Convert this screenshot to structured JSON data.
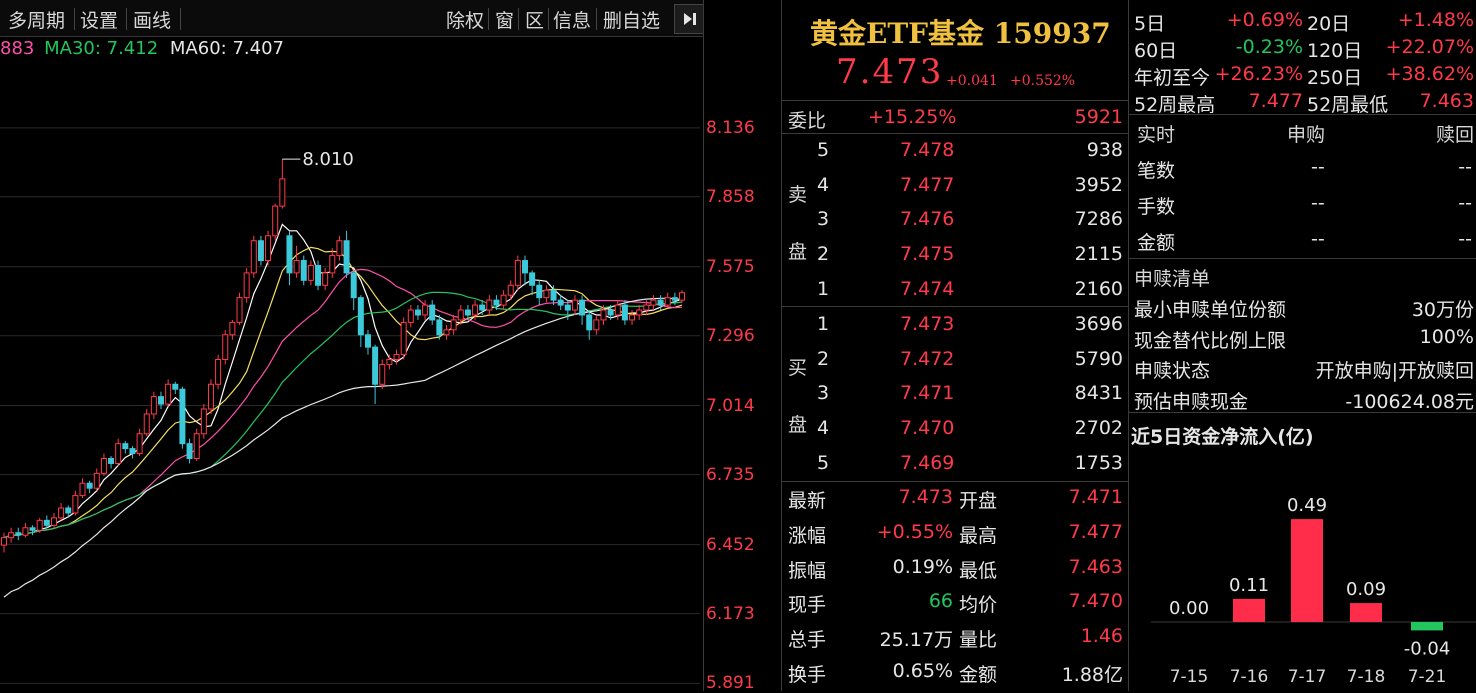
{
  "toolbar": {
    "multi_period": "多周期",
    "settings": "设置",
    "draw_line": "画线",
    "ex_right": "除权",
    "window": "窗",
    "section": "区",
    "info": "信息",
    "remove_watch": "删自选"
  },
  "ma_legend": {
    "ma_partial": "883",
    "ma30": "MA30: 7.412",
    "ma60": "MA60: 7.407"
  },
  "chart_data": {
    "type": "candlestick",
    "y_ticks": [
      "8.136",
      "7.858",
      "7.575",
      "7.296",
      "7.014",
      "6.735",
      "6.452",
      "6.173",
      "5.891"
    ],
    "y_tick_values": [
      8.136,
      7.858,
      7.575,
      7.296,
      7.014,
      6.735,
      6.452,
      6.173,
      5.891
    ],
    "ylim": [
      5.82,
      8.37
    ],
    "peak_label": "8.010",
    "peak_value": 8.01,
    "candles": [
      [
        6.45,
        6.48,
        6.42,
        6.5
      ],
      [
        6.48,
        6.5,
        6.46,
        6.52
      ],
      [
        6.5,
        6.49,
        6.47,
        6.52
      ],
      [
        6.49,
        6.52,
        6.48,
        6.54
      ],
      [
        6.52,
        6.51,
        6.49,
        6.53
      ],
      [
        6.51,
        6.55,
        6.5,
        6.56
      ],
      [
        6.55,
        6.53,
        6.52,
        6.57
      ],
      [
        6.53,
        6.56,
        6.52,
        6.58
      ],
      [
        6.56,
        6.6,
        6.55,
        6.62
      ],
      [
        6.6,
        6.58,
        6.56,
        6.61
      ],
      [
        6.58,
        6.65,
        6.57,
        6.67
      ],
      [
        6.65,
        6.7,
        6.64,
        6.72
      ],
      [
        6.7,
        6.68,
        6.66,
        6.71
      ],
      [
        6.68,
        6.74,
        6.67,
        6.76
      ],
      [
        6.74,
        6.8,
        6.73,
        6.82
      ],
      [
        6.8,
        6.78,
        6.76,
        6.81
      ],
      [
        6.78,
        6.86,
        6.77,
        6.88
      ],
      [
        6.86,
        6.84,
        6.82,
        6.87
      ],
      [
        6.84,
        6.82,
        6.8,
        6.85
      ],
      [
        6.82,
        6.9,
        6.81,
        6.92
      ],
      [
        6.9,
        6.98,
        6.89,
        7.0
      ],
      [
        6.98,
        7.05,
        6.96,
        7.07
      ],
      [
        7.05,
        7.02,
        7.0,
        7.07
      ],
      [
        7.02,
        7.1,
        7.01,
        7.12
      ],
      [
        7.1,
        7.08,
        7.06,
        7.11
      ],
      [
        7.08,
        6.86,
        6.84,
        7.09
      ],
      [
        6.86,
        6.8,
        6.78,
        6.88
      ],
      [
        6.8,
        6.9,
        6.79,
        6.92
      ],
      [
        6.9,
        7.0,
        6.88,
        7.02
      ],
      [
        7.0,
        7.1,
        6.98,
        7.12
      ],
      [
        7.1,
        7.2,
        7.08,
        7.22
      ],
      [
        7.2,
        7.3,
        7.18,
        7.32
      ],
      [
        7.3,
        7.35,
        7.28,
        7.36
      ],
      [
        7.35,
        7.45,
        7.34,
        7.47
      ],
      [
        7.45,
        7.55,
        7.43,
        7.57
      ],
      [
        7.55,
        7.68,
        7.53,
        7.7
      ],
      [
        7.68,
        7.6,
        7.58,
        7.7
      ],
      [
        7.6,
        7.7,
        7.58,
        7.72
      ],
      [
        7.7,
        7.82,
        7.68,
        7.83
      ],
      [
        7.82,
        7.93,
        7.81,
        8.01
      ],
      [
        7.7,
        7.55,
        7.5,
        7.72
      ],
      [
        7.55,
        7.6,
        7.53,
        7.66
      ],
      [
        7.6,
        7.52,
        7.5,
        7.62
      ],
      [
        7.52,
        7.58,
        7.5,
        7.6
      ],
      [
        7.58,
        7.5,
        7.48,
        7.6
      ],
      [
        7.5,
        7.55,
        7.48,
        7.57
      ],
      [
        7.55,
        7.62,
        7.53,
        7.65
      ],
      [
        7.62,
        7.68,
        7.6,
        7.7
      ],
      [
        7.68,
        7.55,
        7.53,
        7.72
      ],
      [
        7.55,
        7.45,
        7.4,
        7.56
      ],
      [
        7.45,
        7.3,
        7.25,
        7.46
      ],
      [
        7.3,
        7.25,
        7.22,
        7.32
      ],
      [
        7.25,
        7.1,
        7.02,
        7.26
      ],
      [
        7.1,
        7.18,
        7.08,
        7.2
      ],
      [
        7.18,
        7.2,
        7.16,
        7.22
      ],
      [
        7.2,
        7.22,
        7.18,
        7.24
      ],
      [
        7.22,
        7.35,
        7.2,
        7.37
      ],
      [
        7.35,
        7.4,
        7.33,
        7.42
      ],
      [
        7.4,
        7.38,
        7.36,
        7.42
      ],
      [
        7.38,
        7.42,
        7.36,
        7.44
      ],
      [
        7.42,
        7.36,
        7.34,
        7.44
      ],
      [
        7.36,
        7.3,
        7.28,
        7.38
      ],
      [
        7.3,
        7.32,
        7.28,
        7.34
      ],
      [
        7.32,
        7.36,
        7.3,
        7.38
      ],
      [
        7.36,
        7.4,
        7.34,
        7.42
      ],
      [
        7.4,
        7.38,
        7.36,
        7.42
      ],
      [
        7.38,
        7.42,
        7.36,
        7.44
      ],
      [
        7.42,
        7.4,
        7.38,
        7.44
      ],
      [
        7.4,
        7.44,
        7.38,
        7.46
      ],
      [
        7.44,
        7.42,
        7.4,
        7.46
      ],
      [
        7.42,
        7.46,
        7.4,
        7.48
      ],
      [
        7.46,
        7.5,
        7.44,
        7.52
      ],
      [
        7.5,
        7.6,
        7.48,
        7.62
      ],
      [
        7.6,
        7.55,
        7.5,
        7.62
      ],
      [
        7.55,
        7.5,
        7.46,
        7.56
      ],
      [
        7.5,
        7.45,
        7.42,
        7.52
      ],
      [
        7.45,
        7.48,
        7.43,
        7.5
      ],
      [
        7.48,
        7.44,
        7.42,
        7.5
      ],
      [
        7.44,
        7.42,
        7.4,
        7.46
      ],
      [
        7.42,
        7.4,
        7.36,
        7.44
      ],
      [
        7.4,
        7.44,
        7.38,
        7.46
      ],
      [
        7.44,
        7.38,
        7.34,
        7.46
      ],
      [
        7.38,
        7.32,
        7.28,
        7.4
      ],
      [
        7.32,
        7.36,
        7.3,
        7.38
      ],
      [
        7.36,
        7.4,
        7.34,
        7.42
      ],
      [
        7.4,
        7.38,
        7.36,
        7.42
      ],
      [
        7.38,
        7.42,
        7.36,
        7.44
      ],
      [
        7.42,
        7.36,
        7.34,
        7.44
      ],
      [
        7.36,
        7.38,
        7.34,
        7.4
      ],
      [
        7.38,
        7.4,
        7.36,
        7.42
      ],
      [
        7.4,
        7.42,
        7.38,
        7.44
      ],
      [
        7.42,
        7.44,
        7.4,
        7.46
      ],
      [
        7.44,
        7.42,
        7.4,
        7.46
      ],
      [
        7.42,
        7.45,
        7.41,
        7.47
      ],
      [
        7.45,
        7.44,
        7.42,
        7.47
      ],
      [
        7.44,
        7.47,
        7.43,
        7.48
      ]
    ]
  },
  "quote": {
    "name": "黄金ETF基金 159937",
    "price": "7.473",
    "change": "+0.041",
    "change_pct": "+0.552%"
  },
  "stats": [
    {
      "l1": "5日",
      "v1": "+0.69%",
      "c1": "red",
      "l2": "20日",
      "v2": "+1.48%",
      "c2": "red"
    },
    {
      "l1": "60日",
      "v1": "-0.23%",
      "c1": "green",
      "l2": "120日",
      "v2": "+22.07%",
      "c2": "red"
    },
    {
      "l1": "年初至今",
      "v1": "+26.23%",
      "c1": "red",
      "l2": "250日",
      "v2": "+38.62%",
      "c2": "red"
    },
    {
      "l1": "52周最高",
      "v1": "7.477",
      "c1": "red",
      "l2": "52周最低",
      "v2": "7.463",
      "c2": "red"
    }
  ],
  "orderbook": {
    "weibi_label": "委比",
    "weibi_value": "+15.25%",
    "weibi_count": "5921",
    "sell_label_1": "卖",
    "sell_label_2": "盘",
    "buy_label_1": "买",
    "buy_label_2": "盘",
    "sell": [
      {
        "level": "5",
        "price": "7.478",
        "vol": "938"
      },
      {
        "level": "4",
        "price": "7.477",
        "vol": "3952"
      },
      {
        "level": "3",
        "price": "7.476",
        "vol": "7286"
      },
      {
        "level": "2",
        "price": "7.475",
        "vol": "2115"
      },
      {
        "level": "1",
        "price": "7.474",
        "vol": "2160"
      }
    ],
    "buy": [
      {
        "level": "1",
        "price": "7.473",
        "vol": "3696"
      },
      {
        "level": "2",
        "price": "7.472",
        "vol": "5790"
      },
      {
        "level": "3",
        "price": "7.471",
        "vol": "8431"
      },
      {
        "level": "4",
        "price": "7.470",
        "vol": "2702"
      },
      {
        "level": "5",
        "price": "7.469",
        "vol": "1753"
      }
    ]
  },
  "detail": [
    {
      "l1": "最新",
      "v1": "7.473",
      "c1": "red",
      "l2": "开盘",
      "v2": "7.471",
      "c2": "red"
    },
    {
      "l1": "涨幅",
      "v1": "+0.55%",
      "c1": "red",
      "l2": "最高",
      "v2": "7.477",
      "c2": "red"
    },
    {
      "l1": "振幅",
      "v1": "0.19%",
      "c1": "white",
      "l2": "最低",
      "v2": "7.463",
      "c2": "red"
    },
    {
      "l1": "现手",
      "v1": "66",
      "c1": "green",
      "l2": "均价",
      "v2": "7.470",
      "c2": "red"
    },
    {
      "l1": "总手",
      "v1": "25.17万",
      "c1": "white",
      "l2": "量比",
      "v2": "1.46",
      "c2": "red"
    },
    {
      "l1": "换手",
      "v1": "0.65%",
      "c1": "white",
      "l2": "金额",
      "v2": "1.88亿",
      "c2": "white"
    }
  ],
  "subscription": {
    "header": {
      "c1": "实时",
      "c2": "申购",
      "c3": "赎回"
    },
    "rows": [
      {
        "label": "笔数",
        "v1": "--",
        "v2": "--"
      },
      {
        "label": "手数",
        "v1": "--",
        "v2": "--"
      },
      {
        "label": "金额",
        "v1": "--",
        "v2": "--"
      }
    ]
  },
  "subscription_list": {
    "title": "申赎清单",
    "rows": [
      {
        "label": "最小申赎单位份额",
        "value": "30万份"
      },
      {
        "label": "现金替代比例上限",
        "value": "100%"
      },
      {
        "label": "申赎状态",
        "value": "开放申购|开放赎回"
      },
      {
        "label": "预估申赎现金",
        "value": "-100624.08元"
      }
    ]
  },
  "inflow_chart": {
    "title": "近5日资金净流入(亿)",
    "type": "bar",
    "categories": [
      "7-15",
      "7-16",
      "7-17",
      "7-18",
      "7-21"
    ],
    "values": [
      0.0,
      0.11,
      0.49,
      0.09,
      -0.04
    ],
    "labels": [
      "0.00",
      "0.11",
      "0.49",
      "0.09",
      "-0.04"
    ],
    "positive_color": "#ff2d4a",
    "negative_color": "#22c55e"
  }
}
